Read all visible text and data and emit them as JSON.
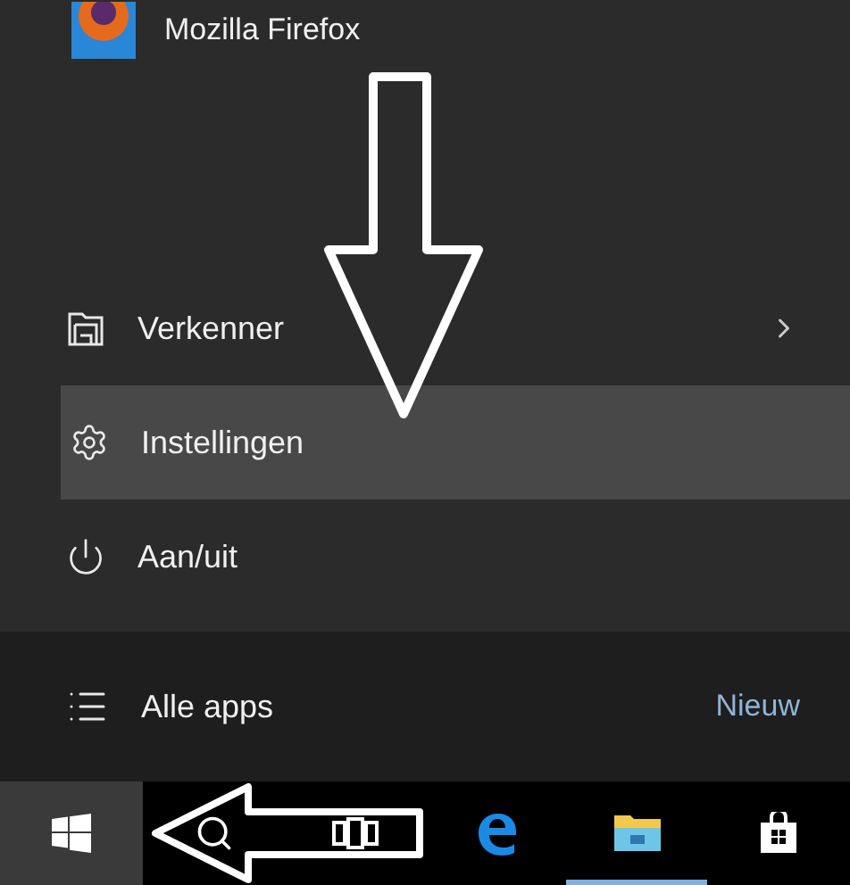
{
  "pinned_app": {
    "label": "Mozilla Firefox"
  },
  "menu_items": [
    {
      "kind": "folder",
      "label": "Verkenner",
      "has_submenu": true,
      "selected": false
    },
    {
      "kind": "settings",
      "label": "Instellingen",
      "has_submenu": false,
      "selected": true
    },
    {
      "kind": "power",
      "label": "Aan/uit",
      "has_submenu": false,
      "selected": false
    }
  ],
  "all_apps": {
    "label": "Alle apps",
    "badge": "Nieuw"
  },
  "taskbar": {
    "items": [
      {
        "kind": "start",
        "selected": true,
        "running": false
      },
      {
        "kind": "search",
        "selected": false,
        "running": false
      },
      {
        "kind": "task_view",
        "selected": false,
        "running": false
      },
      {
        "kind": "edge",
        "selected": false,
        "running": false
      },
      {
        "kind": "explorer",
        "selected": false,
        "running": true
      },
      {
        "kind": "store",
        "selected": false,
        "running": false
      }
    ]
  }
}
